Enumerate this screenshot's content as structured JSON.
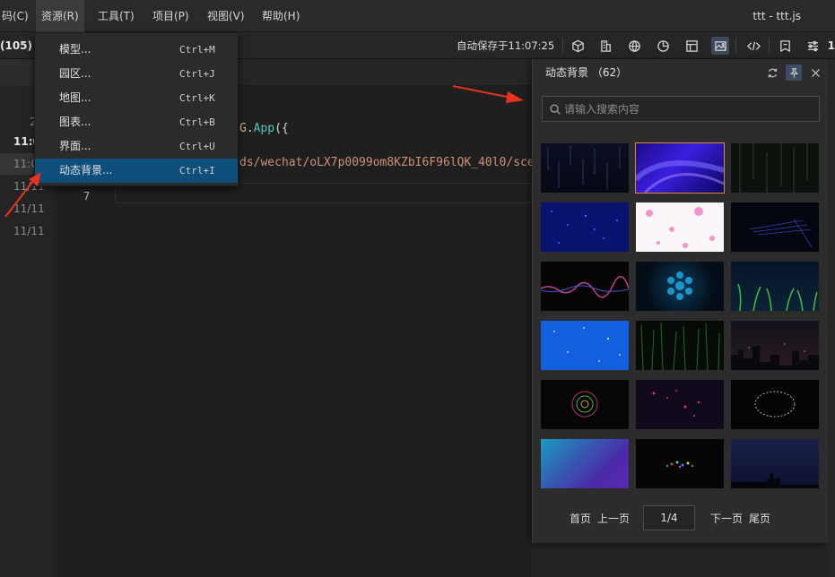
{
  "menubar": {
    "items": [
      "码(C)",
      "资源(R)",
      "工具(T)",
      "项目(P)",
      "视图(V)",
      "帮助(H)"
    ],
    "window_title": "ttt - ttt.js"
  },
  "toolbar": {
    "left_label": "(105)",
    "autosave": "自动保存于11:07:25",
    "right_num": "1"
  },
  "left_panel": {
    "rows": [
      "2",
      "11:0",
      "11:0",
      "11/11",
      "11/11",
      "11/11"
    ],
    "line_marker": "7"
  },
  "editor": {
    "code_line1_class": "G",
    "code_line1_dot": ".",
    "code_line1_method": "App",
    "code_line1_punct": "({",
    "code_line2": "ds/wechat/oLX7p0099om8KZbI6F96lQK_40l0/scen",
    "line_number": "7"
  },
  "dropdown": {
    "items": [
      {
        "label": "模型...",
        "shortcut": "Ctrl+M"
      },
      {
        "label": "园区...",
        "shortcut": "Ctrl+J"
      },
      {
        "label": "地图...",
        "shortcut": "Ctrl+K"
      },
      {
        "label": "图表...",
        "shortcut": "Ctrl+B"
      },
      {
        "label": "界面...",
        "shortcut": "Ctrl+U"
      },
      {
        "label": "动态背景...",
        "shortcut": "Ctrl+I"
      }
    ],
    "selected_index": 5
  },
  "panel": {
    "title": "动态背景 （62）",
    "search_placeholder": "请输入搜索内容",
    "pagination": {
      "first": "首页",
      "prev": "上一页",
      "page": "1/4",
      "next": "下一页",
      "last": "尾页"
    }
  },
  "thumbnails": [
    "rain-dark",
    "purple-waves",
    "dark-rain",
    "blue-particles",
    "pink-bokeh",
    "blue-lines",
    "sound-wave",
    "hexagon-glow",
    "green-grass",
    "blue-stars",
    "green-stalks",
    "city-night",
    "mandala",
    "pink-particles",
    "ring-particles",
    "blue-gradient",
    "colorful-particles",
    "night-silhouette"
  ],
  "colors": {
    "accent_selected": "#0f4d7a",
    "thumb_border_selected": "#e08a30",
    "arrow": "#e8321e",
    "code_class": "#d7ba7d",
    "code_method": "#4ec9b0",
    "code_string": "#ce9178"
  }
}
